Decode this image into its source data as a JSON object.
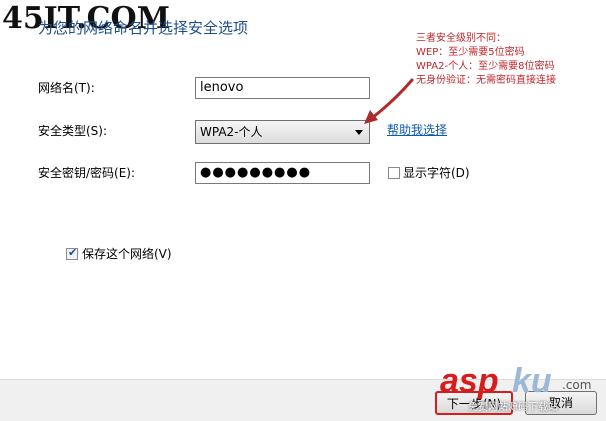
{
  "watermarks": {
    "top_left": "45IT.COM",
    "asp": "asp",
    "ku": "ku",
    "com": ".com",
    "sub": "免费网站源码下载站"
  },
  "heading": "为您的网络命名并选择安全选项",
  "form": {
    "network_name": {
      "label": "网络名(T):",
      "value": "lenovo"
    },
    "security_type": {
      "label": "安全类型(S):",
      "value": "WPA2-个人"
    },
    "security_key": {
      "label": "安全密钥/密码(E):",
      "value": "●●●●●●●●●"
    },
    "show_chars": {
      "label": "显示字符(D)",
      "checked": false
    },
    "save_network": {
      "label": "保存这个网络(V)",
      "checked": true
    },
    "help_link": "帮助我选择"
  },
  "note": {
    "lines": [
      "三者安全级别不同：",
      "WEP：至少需要5位密码",
      "WPA2-个人：至少需要8位密码",
      "无身份验证：无需密码直接连接"
    ],
    "color": "#c0262b"
  },
  "buttons": {
    "next": "下一步(N)",
    "cancel": "取消"
  }
}
